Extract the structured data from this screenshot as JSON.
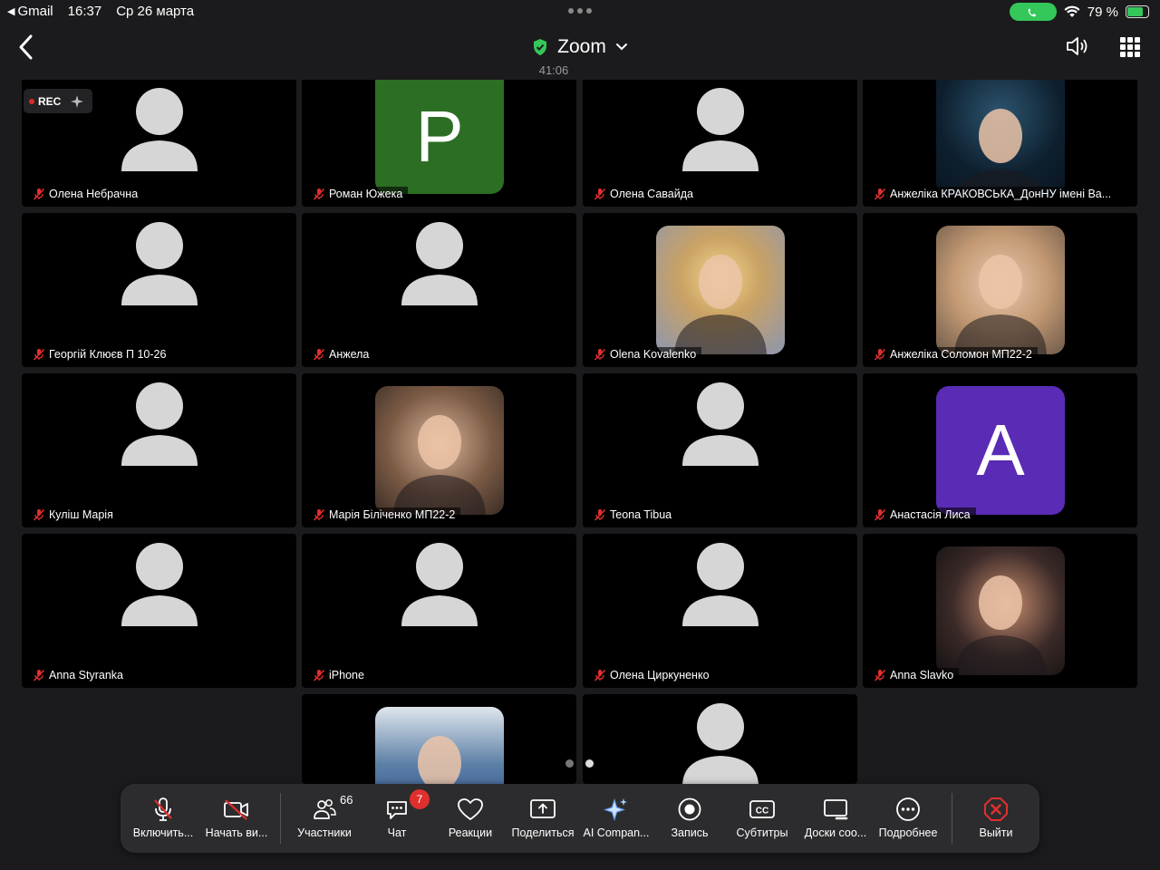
{
  "status_bar": {
    "back_app": "Gmail",
    "time": "16:37",
    "date": "Ср 26 марта",
    "battery": "79 %",
    "battery_level": 0.79
  },
  "header": {
    "title": "Zoom",
    "timer": "41:06"
  },
  "rec_label": "REC",
  "participants": [
    {
      "name": "Олена Небрачна",
      "type": "generic"
    },
    {
      "name": "Роман Южека",
      "type": "letter",
      "letter": "Р",
      "color": "#2c6e23"
    },
    {
      "name": "Олена Савайда",
      "type": "generic"
    },
    {
      "name": "Анжеліка КРАКОВСЬКА_ДонНУ імені Ва...",
      "type": "photo"
    },
    {
      "name": "Георгій Клюєв П 10-26",
      "type": "generic"
    },
    {
      "name": "Анжела",
      "type": "generic"
    },
    {
      "name": "Olena Kovalenko",
      "type": "photo"
    },
    {
      "name": "Анжеліка Соломон МП22-2",
      "type": "photo"
    },
    {
      "name": "Куліш Марія",
      "type": "generic"
    },
    {
      "name": "Марія Біліченко МП22-2",
      "type": "photo"
    },
    {
      "name": "Teona Tibua",
      "type": "generic"
    },
    {
      "name": "Анастасія Лиса",
      "type": "letter",
      "letter": "A",
      "color": "#5a2bb5"
    },
    {
      "name": "Anna Styranka",
      "type": "generic"
    },
    {
      "name": "iPhone",
      "type": "generic"
    },
    {
      "name": "Олена Циркуненко",
      "type": "generic"
    },
    {
      "name": "Anna Slavko",
      "type": "photo"
    },
    {
      "name": "",
      "type": "photo"
    },
    {
      "name": "",
      "type": "generic"
    }
  ],
  "toolbar": {
    "unmute": "Включить...",
    "start_video": "Начать ви...",
    "participants": "Участники",
    "participants_count": "66",
    "chat": "Чат",
    "chat_badge": "7",
    "reactions": "Реакции",
    "share": "Поделиться",
    "ai": "AI Compan...",
    "record": "Запись",
    "subtitles": "Субтитры",
    "whiteboards": "Доски соо...",
    "more": "Подробнее",
    "leave": "Выйти"
  },
  "colors": {
    "background": "#1b1b1d",
    "tile": "#000000",
    "toolbar": "#2c2c2e",
    "accent_green": "#34c759",
    "leave_red": "#e0302e"
  }
}
